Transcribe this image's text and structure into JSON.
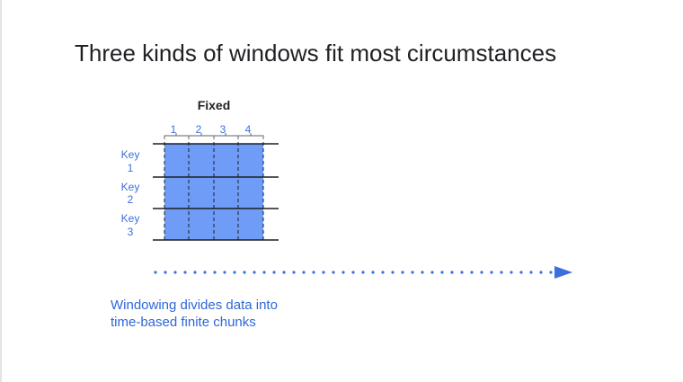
{
  "slide": {
    "title": "Three kinds of windows fit most circumstances"
  },
  "diagram": {
    "window_type_label": "Fixed",
    "window_numbers": [
      "1",
      "2",
      "3",
      "4"
    ],
    "keys": [
      {
        "line1": "Key",
        "line2": "1"
      },
      {
        "line1": "Key",
        "line2": "2"
      },
      {
        "line1": "Key",
        "line2": "3"
      }
    ],
    "fill_color": "#6e9cf7",
    "accent_color": "#3a6fe0"
  },
  "caption": {
    "line1": "Windowing divides data into",
    "line2": "time-based finite chunks"
  }
}
